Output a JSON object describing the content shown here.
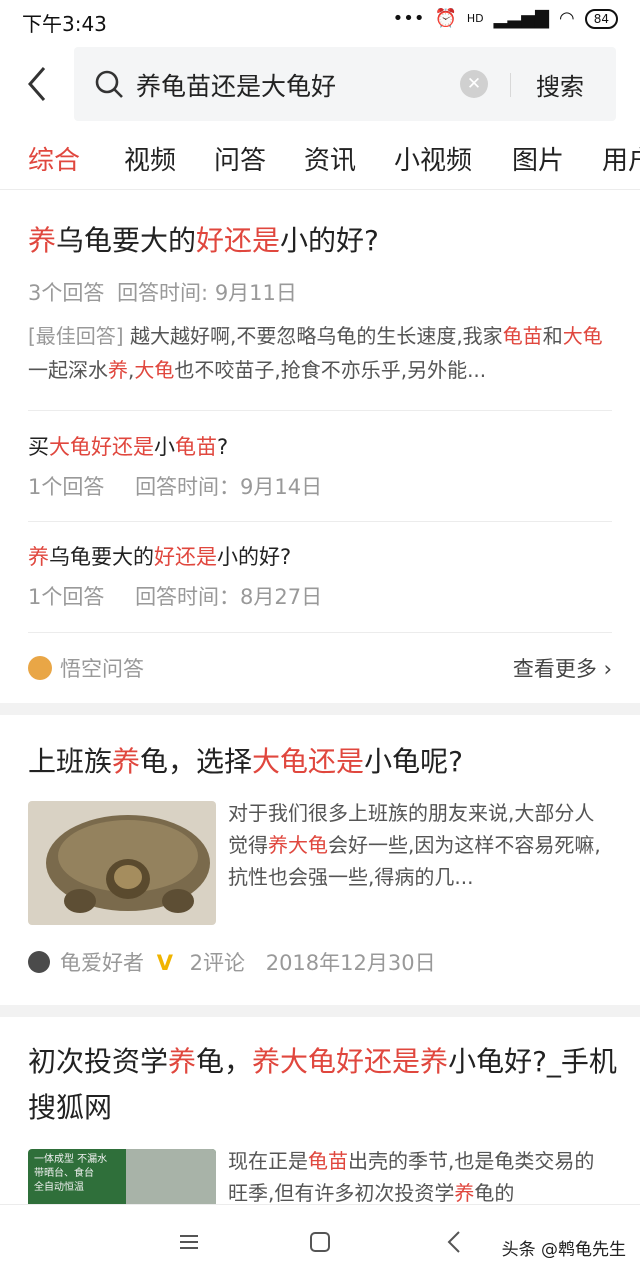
{
  "status_bar": {
    "time": "下午3:43",
    "battery": "84",
    "signal_label": "HD"
  },
  "search": {
    "query": "养龟苗还是大龟好",
    "button_label": "搜索"
  },
  "tabs": [
    "综合",
    "视频",
    "问答",
    "资讯",
    "小视频",
    "图片",
    "用户"
  ],
  "qa_card": {
    "top": {
      "title_parts": [
        [
          "养",
          true
        ],
        [
          "乌龟要大的",
          false
        ],
        [
          "好还是",
          true
        ],
        [
          "小的好?",
          false
        ]
      ],
      "answers": "3个回答",
      "time": "回答时间: 9月11日",
      "excerpt_prefix": "[最佳回答]",
      "excerpt_parts": [
        [
          " 越大越好啊,不要忽略乌龟的生长速度,我家",
          false
        ],
        [
          "龟苗",
          true
        ],
        [
          "和",
          false
        ],
        [
          "大龟",
          true
        ],
        [
          "一起深水",
          false
        ],
        [
          "养",
          true
        ],
        [
          ",",
          false
        ],
        [
          "大龟",
          true
        ],
        [
          "也不咬苗子,抢食不亦乐乎,另外能...",
          false
        ]
      ]
    },
    "rows": [
      {
        "title_parts": [
          [
            "买",
            false
          ],
          [
            "大龟好还是",
            true
          ],
          [
            "小",
            false
          ],
          [
            "龟苗",
            true
          ],
          [
            "?",
            false
          ]
        ],
        "answers": "1个回答",
        "time": "回答时间：9月14日"
      },
      {
        "title_parts": [
          [
            "养",
            true
          ],
          [
            "乌龟要大的",
            false
          ],
          [
            "好还是",
            true
          ],
          [
            "小的好?",
            false
          ]
        ],
        "answers": "1个回答",
        "time": "回答时间：8月27日"
      }
    ],
    "source": "悟空问答",
    "more": "查看更多"
  },
  "article1": {
    "title_parts": [
      [
        "上班族",
        false
      ],
      [
        "养",
        true
      ],
      [
        "龟，选择",
        false
      ],
      [
        "大龟还是",
        true
      ],
      [
        "小龟呢?",
        false
      ]
    ],
    "excerpt_parts": [
      [
        "对于我们很多上班族的朋友来说,大部分人觉得",
        false
      ],
      [
        "养大龟",
        true
      ],
      [
        "会好一些,因为这样不容易死嘛,抗性也会强一些,得病的几...",
        false
      ]
    ],
    "author": "龟爱好者",
    "badge": "V",
    "comments": "2评论",
    "date": "2018年12月30日"
  },
  "article2": {
    "title_parts": [
      [
        "初次投资学",
        false
      ],
      [
        "养",
        true
      ],
      [
        "龟，",
        false
      ],
      [
        "养大龟好还是养",
        true
      ],
      [
        "小龟好?_手机搜狐网",
        false
      ]
    ],
    "excerpt_parts": [
      [
        "现在正是",
        false
      ],
      [
        "龟苗",
        true
      ],
      [
        "出壳的季节,也是龟类交易的旺季,但有许多初次投资学",
        false
      ],
      [
        "养",
        true
      ],
      [
        "龟的",
        false
      ]
    ],
    "thumb_lines": [
      "一体成型 不漏水",
      "带晒台、食台",
      "全自动恒温"
    ]
  },
  "watermark": "头条 @鹎龟先生",
  "colors": {
    "accent": "#e0473e",
    "muted": "#999999",
    "background": "#ffffff",
    "separator": "#f2f2f2"
  }
}
